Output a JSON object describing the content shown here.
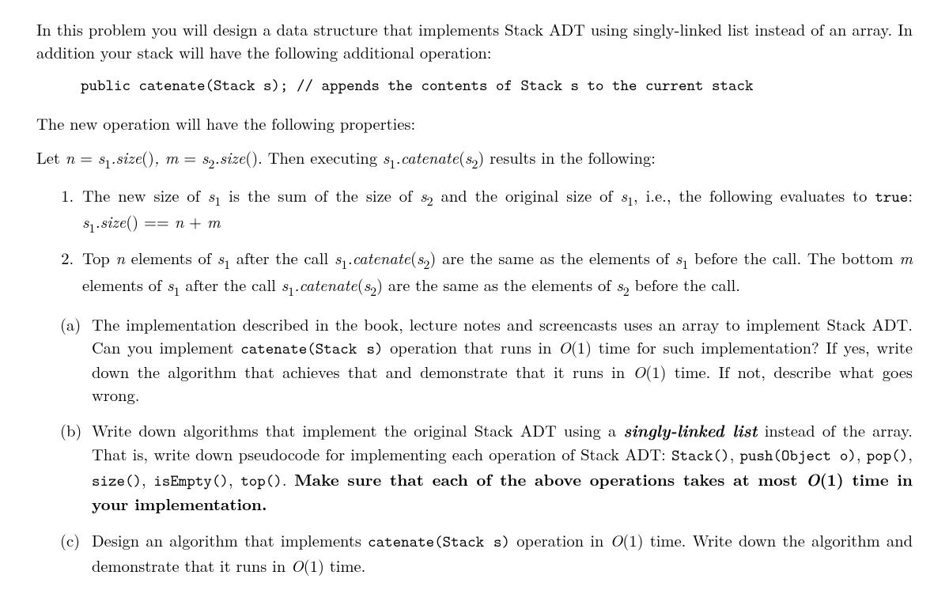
{
  "intro1": "In this problem you will design a data structure that implements Stack ADT using singly-linked list instead of an array. In addition your stack will have the following additional operation:",
  "codeLine": "public catenate(Stack s); // appends the contents of Stack s to the current stack",
  "intro2": "The new operation will have the following properties:",
  "letPrefix": "Let ",
  "letN": "n",
  "eq": " = ",
  "s1": "s",
  "sub1": "1",
  "dot": ".",
  "size": "size",
  "parens": "()",
  "comma": ", ",
  "letM": "m",
  "s2": "s",
  "sub2": "2",
  "letSuffix1": ". Then executing ",
  "catenate": "catenate",
  "open": "(",
  "close": ")",
  "letSuffix2": " results in the following:",
  "enum1_a": "The new size of ",
  "enum1_b": " is the sum of the size of ",
  "enum1_c": " and the original size of ",
  "enum1_d": ", i.e., the following evaluates to ",
  "true": "true",
  "enum1_e": ": ",
  "deq": " == ",
  "plus": " + ",
  "enum2_a": "Top ",
  "enum2_b": " elements of ",
  "enum2_c": " after the call ",
  "enum2_d": " are the same as the elements of ",
  "enum2_e": " before the call. The bottom ",
  "enum2_f": " elements of ",
  "enum2_g": " after the call ",
  "enum2_h": " are the same as the elements of ",
  "enum2_i": " before the call.",
  "a_lbl": "(a)",
  "a_1": "The implementation described in the book, lecture notes and screencasts uses an array to implement Stack ADT. Can you implement ",
  "catS": "catenate(Stack s)",
  "a_2": " operation that runs in ",
  "O1": "O",
  "O1arg": "(1)",
  "a_3": " time for such implementation? If yes, write down the algorithm that achieves that and demonstrate that it runs in ",
  "a_4": " time. If not, describe what goes wrong.",
  "b_lbl": "(b)",
  "b_1": "Write down algorithms that implement the original Stack ADT using a ",
  "sll": "singly-linked list",
  "b_2": " instead of the array. That is, write down pseudocode for implementing each operation of Stack ADT: ",
  "ops": "Stack()",
  "sep": ", ",
  "op2": "push(Object o)",
  "op3": "pop()",
  "op4": "size()",
  "op5": "isEmpty()",
  "op6": "top()",
  "b_3": ". ",
  "b_bold1": "Make sure that each of the above operations takes at most ",
  "b_bold2": " time in your implementation.",
  "c_lbl": "(c)",
  "c_1": "Design an algorithm that implements ",
  "c_2": " operation in ",
  "c_3": " time. Write down the algorithm and demonstrate that it runs in ",
  "c_4": " time."
}
